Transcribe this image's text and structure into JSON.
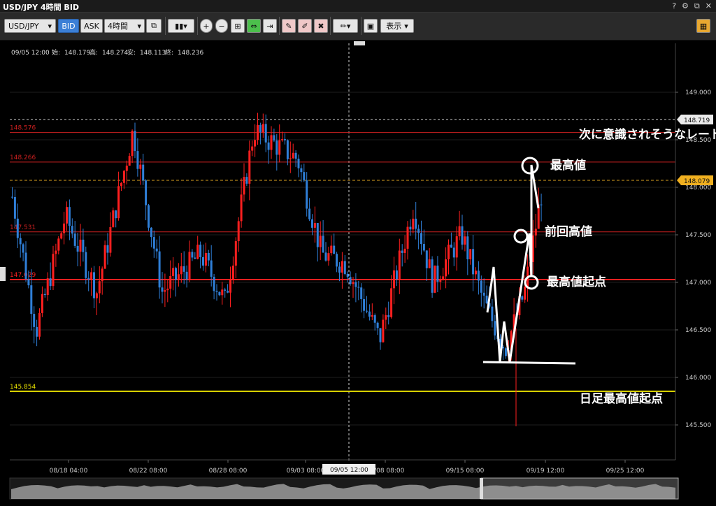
{
  "window": {
    "title": "USD/JPY 4時間 BID"
  },
  "window_controls": [
    "?",
    "⚙",
    "⧉",
    "✕"
  ],
  "toolbar": {
    "symbol": "USD/JPY",
    "bid_label": "BID",
    "ask_label": "ASK",
    "timeframe": "4時間",
    "display_label": "表示"
  },
  "chart": {
    "info": {
      "date": "09/05 12:00",
      "open_label": "始:",
      "open": "148.179",
      "high_label": "高:",
      "high": "148.274",
      "low_label": "安:",
      "low": "148.113",
      "close_label": "終:",
      "close": "148.236"
    },
    "y_ticks": [
      "149.000",
      "148.500",
      "148.000",
      "147.500",
      "147.000",
      "146.500",
      "146.000",
      "145.500"
    ],
    "x_ticks": [
      "08/18 04:00",
      "08/22 08:00",
      "08/28 08:00",
      "09/03 08:00",
      "09/08 08:00",
      "09/15 08:00",
      "09/19 12:00",
      "09/25 12:00"
    ],
    "crosshair_label": "09/05 12:00",
    "price_tags": {
      "top": "148.719",
      "current": "148.079"
    },
    "levels": [
      {
        "label": "148.576",
        "price": 148.576,
        "color": "#cc2020"
      },
      {
        "label": "148.266",
        "price": 148.266,
        "color": "#cc2020"
      },
      {
        "label": "147.531",
        "price": 147.531,
        "color": "#cc2020"
      },
      {
        "label": "147.029",
        "price": 147.029,
        "color": "#ff2020"
      },
      {
        "label": "145.854",
        "price": 145.854,
        "color": "#e8e000"
      }
    ],
    "annotations": {
      "next_rate": "次に意識されそうなレート",
      "highest": "最高値",
      "previous_high": "前回高値",
      "highest_start": "最高値起点",
      "daily_highest_start": "日足最高値起点"
    },
    "colors": {
      "up": "#ff1f1f",
      "down": "#2f7fd8",
      "background": "#000000",
      "annotation": "#ffffff"
    }
  }
}
